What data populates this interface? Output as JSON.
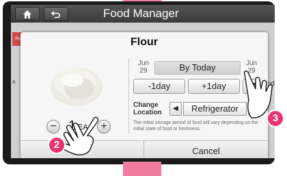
{
  "topbar": {
    "title": "Food Manager",
    "home_icon": "home-icon",
    "back_icon": "back-icon"
  },
  "background": {
    "tab_label": "Re",
    "left_label": "A",
    "right_label": "od"
  },
  "dialog": {
    "title": "Flour",
    "quantity": {
      "value": "1",
      "unit": "EA",
      "minus": "−",
      "plus": "+"
    },
    "date_left": {
      "month": "Jun",
      "day": "29"
    },
    "date_right": {
      "month": "Jun",
      "day": "29"
    },
    "by_today": "By Today",
    "minus_day": "-1day",
    "plus_day": "+1day",
    "change_location_line1": "Change",
    "change_location_line2": "Location",
    "location_value": "Refrigerator",
    "location_prev": "◀",
    "location_next": "▶",
    "note": "The initial storage period of food will vary depending on the initial state of food or freshness.",
    "ok_label": "",
    "cancel_label": "Cancel"
  },
  "callouts": {
    "two": "2",
    "three": "3"
  },
  "colors": {
    "accent_pink": "#f07aa0",
    "callout": "#e8336e"
  }
}
